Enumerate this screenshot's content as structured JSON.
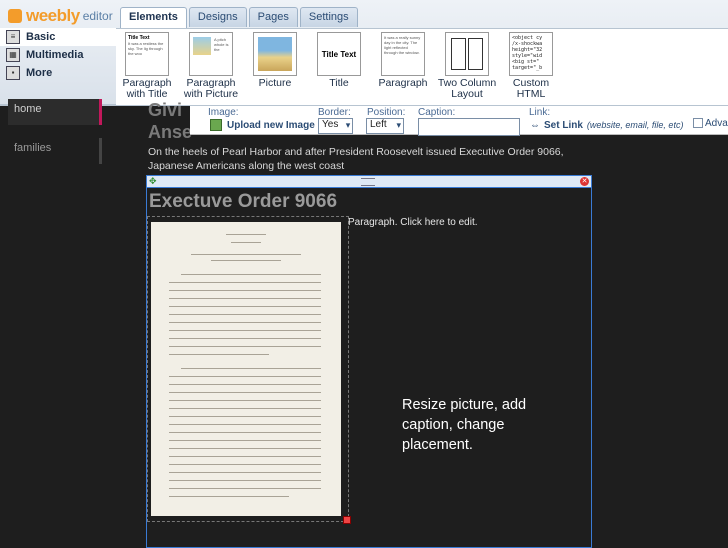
{
  "logo": {
    "brand": "weebly",
    "sub": "editor"
  },
  "tabs": [
    {
      "label": "Elements",
      "active": true
    },
    {
      "label": "Designs",
      "active": false
    },
    {
      "label": "Pages",
      "active": false
    },
    {
      "label": "Settings",
      "active": false
    }
  ],
  "categories": [
    {
      "label": "Basic",
      "icon": "document-icon",
      "selected": true
    },
    {
      "label": "Multimedia",
      "icon": "film-icon",
      "selected": false
    },
    {
      "label": "More",
      "icon": "grid-icon",
      "selected": false
    }
  ],
  "elements": [
    {
      "label1": "Paragraph",
      "label2": "with Title",
      "thumb_title": "Title Text",
      "thumb_body": "It was a restless the sky. The lig through the woo"
    },
    {
      "label1": "Paragraph",
      "label2": "with Picture",
      "thumb_title": "",
      "thumb_body": "A pitch whole is the"
    },
    {
      "label1": "Picture",
      "label2": "",
      "thumb_title": "",
      "thumb_body": ""
    },
    {
      "label1": "Title",
      "label2": "",
      "thumb_title": "Title Text",
      "thumb_body": ""
    },
    {
      "label1": "Paragraph",
      "label2": "",
      "thumb_title": "",
      "thumb_body": "It was a really sunny day in the city. The light reflected through the window."
    },
    {
      "label1": "Two Column",
      "label2": "Layout",
      "thumb_title": "",
      "thumb_body": ""
    },
    {
      "label1": "Custom",
      "label2": "HTML",
      "thumb_title": "",
      "thumb_body": "<object cy /x-shockwa height=\"32 style=\"wid <big st=\" target=\"_b"
    }
  ],
  "properties": {
    "image_label": "Image:",
    "upload_label": "Upload new Image",
    "border_label": "Border:",
    "border_value": "Yes",
    "position_label": "Position:",
    "position_value": "Left",
    "caption_label": "Caption:",
    "caption_value": "",
    "link_label": "Link:",
    "set_link_label": "Set Link",
    "set_link_hint": "(website, email, file, etc)",
    "advanced_label": "Adva"
  },
  "nav": [
    {
      "label": "home"
    },
    {
      "label": "families"
    }
  ],
  "page": {
    "heading_partial": "Givi\nAnse",
    "intro": "On the heels of Pearl Harbor and after President Roosevelt issued Executive Order 9066, Japanese Americans along the west coast",
    "element_title": "Exectuve Order 9066",
    "paragraph_placeholder": "Paragraph. Click here to edit."
  },
  "callout": "Resize picture, add caption, change placement."
}
